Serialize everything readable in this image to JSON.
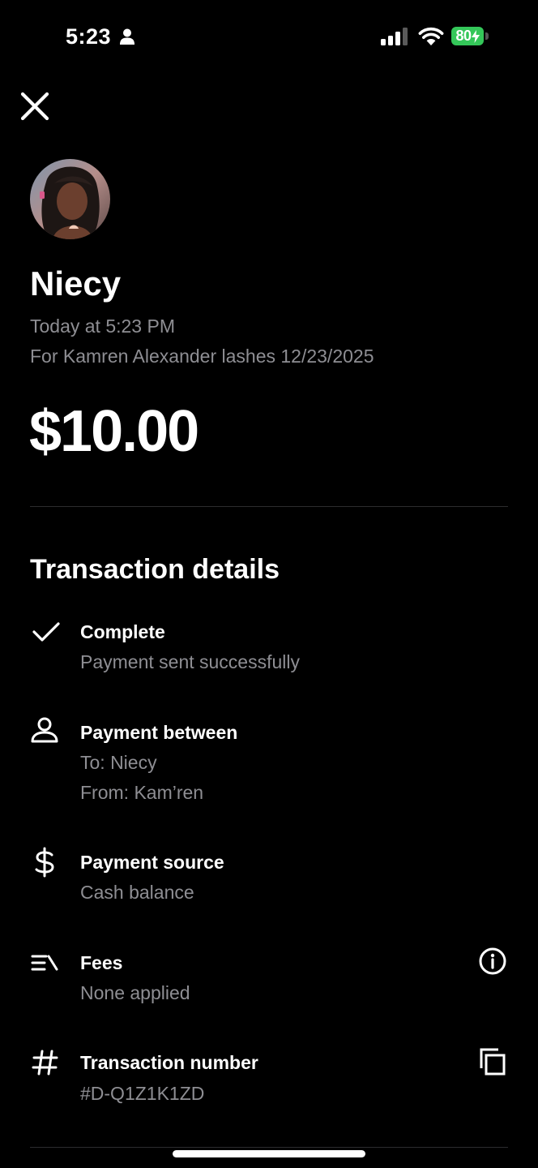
{
  "status_bar": {
    "time": "5:23",
    "battery": "80"
  },
  "icons": {
    "close": "close-icon",
    "check": "checkmark-icon",
    "person": "person-icon",
    "dollar": "dollar-sign-icon",
    "fees": "fees-list-icon",
    "info": "info-icon",
    "hash": "hash-icon",
    "copy": "copy-icon"
  },
  "header": {
    "name": "Niecy",
    "date": "Today at 5:23 PM",
    "note": "For Kamren Alexander lashes 12/23/2025",
    "amount": "$10.00"
  },
  "details": {
    "title": "Transaction details",
    "rows": [
      {
        "title": "Complete",
        "lines": [
          "Payment sent successfully"
        ]
      },
      {
        "title": "Payment between",
        "lines": [
          "To: Niecy",
          "From: Kam’ren"
        ]
      },
      {
        "title": "Payment source",
        "lines": [
          "Cash balance"
        ]
      },
      {
        "title": "Fees",
        "lines": [
          "None applied"
        ]
      },
      {
        "title": "Transaction number",
        "lines": [
          "#D-Q1Z1K1ZD"
        ]
      }
    ]
  },
  "colors": {
    "background": "#000000",
    "text": "#ffffff",
    "secondary_text": "#8e8e93",
    "battery": "#34c759",
    "divider": "#2c2c2e"
  }
}
